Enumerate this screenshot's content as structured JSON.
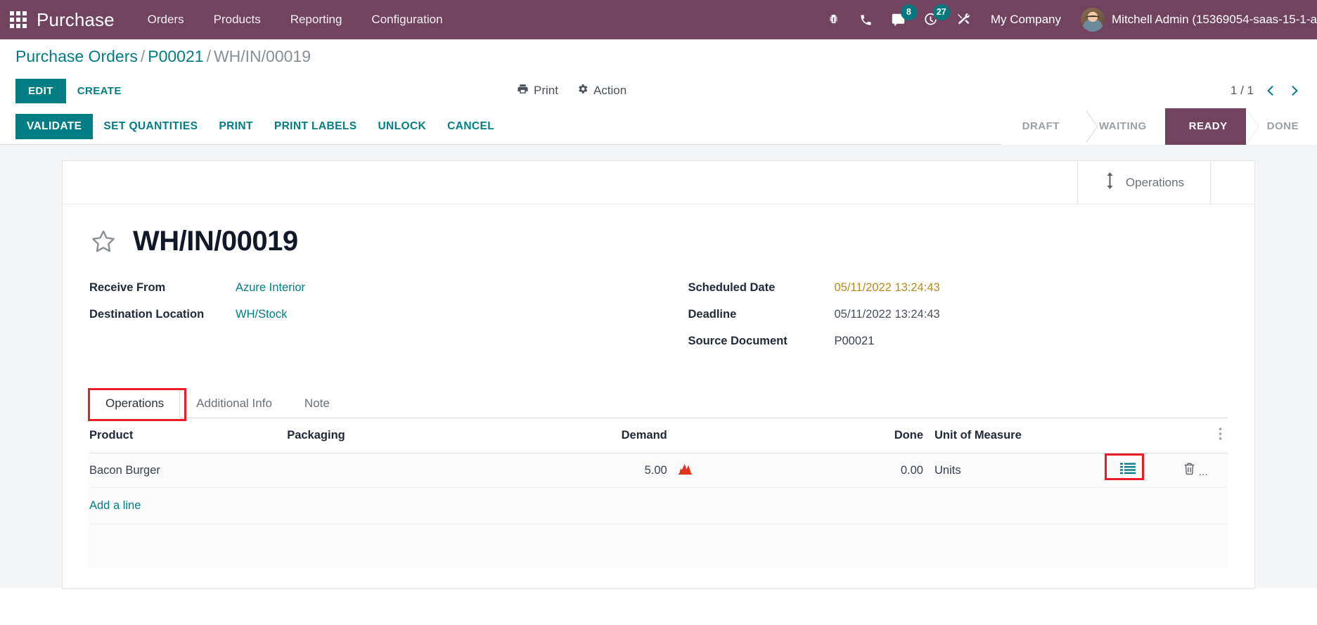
{
  "navbar": {
    "apps_icon": "apps-grid-icon",
    "brand": "Purchase",
    "menus": [
      "Orders",
      "Products",
      "Reporting",
      "Configuration"
    ],
    "icons": [
      {
        "name": "bug-icon",
        "badge": null
      },
      {
        "name": "phone-icon",
        "badge": null
      },
      {
        "name": "messages-icon",
        "badge": "8"
      },
      {
        "name": "activities-clock-icon",
        "badge": "27"
      },
      {
        "name": "tools-wrench-icon",
        "badge": null
      }
    ],
    "company": "My Company",
    "user": "Mitchell Admin (15369054-saas-15-1-a"
  },
  "breadcrumb": {
    "root": "Purchase Orders",
    "parent": "P00021",
    "current": "WH/IN/00019",
    "separator": "/"
  },
  "control_panel": {
    "edit": "EDIT",
    "create": "CREATE",
    "print": "Print",
    "action": "Action",
    "pager": "1 / 1"
  },
  "statusbar": {
    "buttons": [
      "VALIDATE",
      "SET QUANTITIES",
      "PRINT",
      "PRINT LABELS",
      "UNLOCK",
      "CANCEL"
    ],
    "primary_button": "VALIDATE",
    "stages": [
      "DRAFT",
      "WAITING",
      "READY",
      "DONE"
    ],
    "active_stage": "READY",
    "active_color": "#71435f"
  },
  "smart_buttons": [
    {
      "label": "Operations",
      "icon": "arrows-vertical-icon"
    }
  ],
  "record": {
    "star_icon": "star-outline-icon",
    "title": "WH/IN/00019",
    "fields_left": [
      {
        "label": "Receive From",
        "value": "Azure Interior",
        "style": "link"
      },
      {
        "label": "Destination Location",
        "value": "WH/Stock",
        "style": "link"
      }
    ],
    "fields_right": [
      {
        "label": "Scheduled Date",
        "value": "05/11/2022 13:24:43",
        "style": "warn"
      },
      {
        "label": "Deadline",
        "value": "05/11/2022 13:24:43",
        "style": "muted"
      },
      {
        "label": "Source Document",
        "value": "P00021",
        "style": "plain"
      }
    ]
  },
  "notebook": {
    "tabs": [
      {
        "label": "Operations",
        "active": true,
        "highlighted": true
      },
      {
        "label": "Additional Info",
        "active": false,
        "highlighted": false
      },
      {
        "label": "Note",
        "active": false,
        "highlighted": false
      }
    ],
    "columns": [
      "Product",
      "Packaging",
      "Demand",
      "Done",
      "Unit of Measure"
    ],
    "optional_columns_icon": "optional-columns-icon",
    "rows": [
      {
        "product": "Bacon Burger",
        "packaging": "",
        "demand": "5.00",
        "demand_icon": "forecast-report-icon",
        "done": "0.00",
        "uom": "Units",
        "detail_icon": "detailed-operations-icon",
        "detail_icon_highlighted": true,
        "delete_icon": "trash-icon",
        "overflow": "..."
      }
    ],
    "add_line": "Add a line"
  },
  "colors": {
    "brand_purple": "#71435f",
    "accent_teal": "#017e84",
    "warning_amber": "#b98a1e",
    "annotation_red": "#ec1c24",
    "badge_teal": "#00787d"
  }
}
